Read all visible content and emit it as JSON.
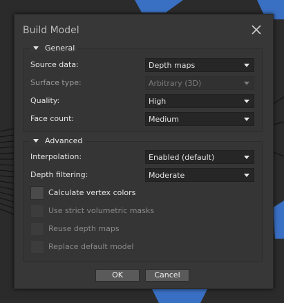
{
  "dialog": {
    "title": "Build Model"
  },
  "general": {
    "heading": "General",
    "rows": [
      {
        "label": "Source data:",
        "value": "Depth maps",
        "enabled": true
      },
      {
        "label": "Surface type:",
        "value": "Arbitrary (3D)",
        "enabled": false
      },
      {
        "label": "Quality:",
        "value": "High",
        "enabled": true
      },
      {
        "label": "Face count:",
        "value": "Medium",
        "enabled": true
      }
    ]
  },
  "advanced": {
    "heading": "Advanced",
    "rows": [
      {
        "label": "Interpolation:",
        "value": "Enabled (default)",
        "enabled": true
      },
      {
        "label": "Depth filtering:",
        "value": "Moderate",
        "enabled": true
      }
    ],
    "checkboxes": [
      {
        "label": "Calculate vertex colors",
        "checked": false,
        "enabled": true
      },
      {
        "label": "Use strict volumetric masks",
        "checked": false,
        "enabled": false
      },
      {
        "label": "Reuse depth maps",
        "checked": false,
        "enabled": false
      },
      {
        "label": "Replace default model",
        "checked": false,
        "enabled": false
      }
    ]
  },
  "buttons": {
    "ok": "OK",
    "cancel": "Cancel"
  },
  "colors": {
    "dialog_bg": "#373737",
    "combo_bg": "#262626",
    "button_bg": "#5a5a5a",
    "accent_blue": "#3a70c4"
  }
}
